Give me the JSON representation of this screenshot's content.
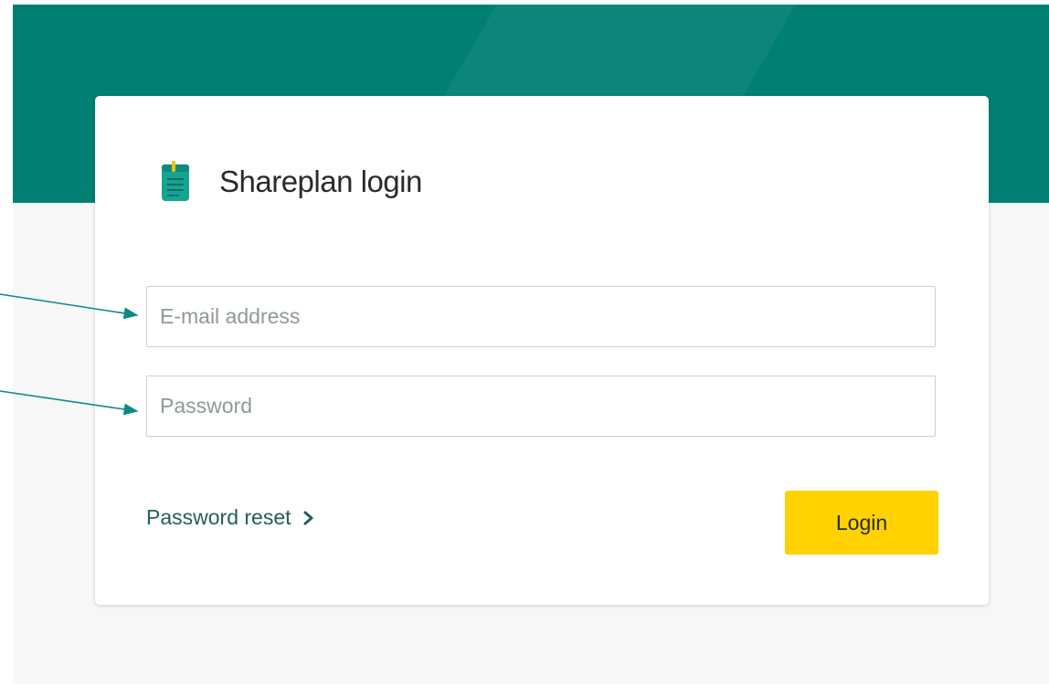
{
  "header": {
    "title": "Shareplan login",
    "logo_icon": "notepad-icon"
  },
  "form": {
    "email_placeholder": "E-mail address",
    "password_placeholder": "Password",
    "password_reset_label": "Password reset",
    "login_label": "Login"
  },
  "colors": {
    "header_teal": "#007f72",
    "background": "#f7f7f7",
    "login_button": "#ffd200",
    "link_text": "#235f5a",
    "annotation_arrow": "#0b8a84"
  }
}
